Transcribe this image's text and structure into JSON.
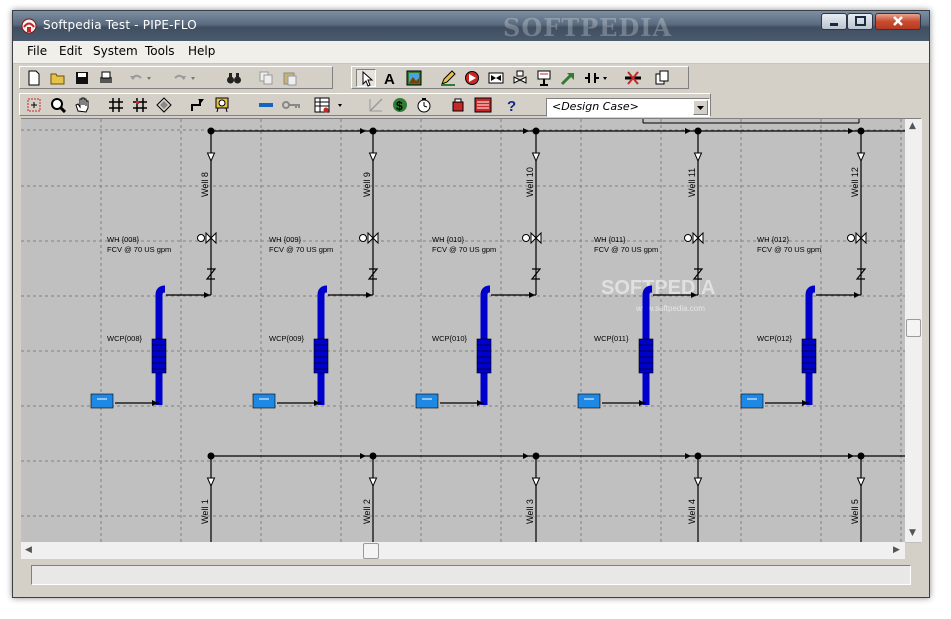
{
  "window": {
    "title": "Softpedia Test  -  PIPE-FLO"
  },
  "watermark": {
    "title_bar": "SOFTPEDIA",
    "canvas": "SOFTPEDIA",
    "canvas_url": "www.softpedia.com"
  },
  "menu": [
    "File",
    "Edit",
    "System",
    "Tools",
    "Help"
  ],
  "toolbar": {
    "design_case": "<Design Case>",
    "icons_row1": [
      "new-file-icon",
      "open-folder-icon",
      "save-icon",
      "print-icon",
      "undo-icon",
      "redo-icon",
      "find-binoculars-icon",
      "copy-icon",
      "paste-icon",
      "select-arrow-icon",
      "text-tool-icon",
      "picture-icon",
      "pipe-pencil-icon",
      "pump-icon",
      "valve-icon",
      "control-valve-icon",
      "heat-exchanger-icon",
      "flow-arrow-icon",
      "inline-component-icon",
      "delete-component-icon",
      "duplicate-icon"
    ],
    "icons_row2": [
      "zoom-window-icon",
      "zoom-icon",
      "pan-hand-icon",
      "grid-icon",
      "snap-grid-icon",
      "align-icon",
      "route-icon",
      "display-icon",
      "pipe-color-icon",
      "key-icon",
      "table-report-icon",
      "curve-icon",
      "calculate-icon",
      "timer-icon",
      "tank-report-icon",
      "report-icon",
      "help-icon"
    ]
  },
  "diagram": {
    "colors": {
      "background": "#c0c0c0",
      "pipe": "#000000",
      "pump": "#0000cc",
      "tank": "#1e88e5"
    },
    "top_wells": [
      {
        "well": "Well 8",
        "wh": "WH {008}",
        "fcv": "FCV @ 70 US gpm",
        "wcp": "WCP{008}"
      },
      {
        "well": "Well 9",
        "wh": "WH {009}",
        "fcv": "FCV @ 70 US gpm",
        "wcp": "WCP{009}"
      },
      {
        "well": "Well 10",
        "wh": "WH {010}",
        "fcv": "FCV @ 70 US gpm",
        "wcp": "WCP{010}"
      },
      {
        "well": "Well 11",
        "wh": "WH {011}",
        "fcv": "FCV @ 70 US gpm",
        "wcp": "WCP{011}"
      },
      {
        "well": "Well 12",
        "wh": "WH {012}",
        "fcv": "FCV @ 70 US gpm",
        "wcp": "WCP{012}"
      }
    ],
    "bottom_wells": [
      "Well 1",
      "Well 2",
      "Well 3",
      "Well 4",
      "Well 5"
    ]
  },
  "status": {
    "text": ""
  }
}
